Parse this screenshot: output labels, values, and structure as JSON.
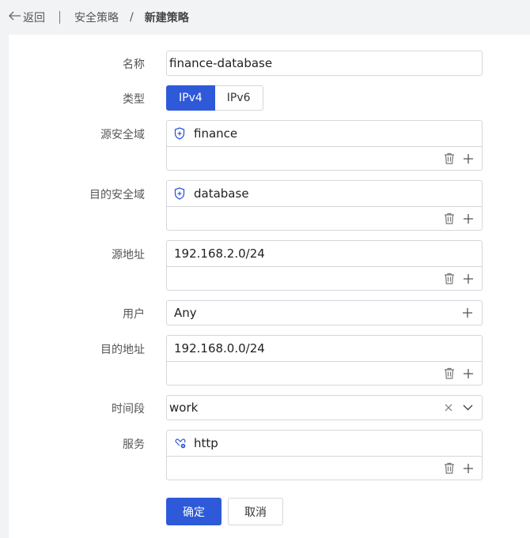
{
  "topbar": {
    "back_label": "返回",
    "breadcrumb": [
      "安全策略",
      "新建策略"
    ],
    "crumb_separator": "/"
  },
  "form": {
    "name": {
      "label": "名称",
      "value": "finance-database"
    },
    "type": {
      "label": "类型",
      "options": [
        "IPv4",
        "IPv6"
      ],
      "selected": "IPv4"
    },
    "src_zone": {
      "label": "源安全域",
      "value": "finance",
      "icon": "shield-icon"
    },
    "dst_zone": {
      "label": "目的安全域",
      "value": "database",
      "icon": "shield-icon"
    },
    "src_addr": {
      "label": "源地址",
      "value": "192.168.2.0/24"
    },
    "user": {
      "label": "用户",
      "value": "Any"
    },
    "dst_addr": {
      "label": "目的地址",
      "value": "192.168.0.0/24"
    },
    "schedule": {
      "label": "时间段",
      "value": "work"
    },
    "service": {
      "label": "服务",
      "value": "http",
      "icon": "service-icon"
    }
  },
  "actions": {
    "confirm": "确定",
    "cancel": "取消"
  },
  "colors": {
    "primary": "#2e59d9",
    "border": "#d5d7dc",
    "background": "#f2f3f5"
  }
}
